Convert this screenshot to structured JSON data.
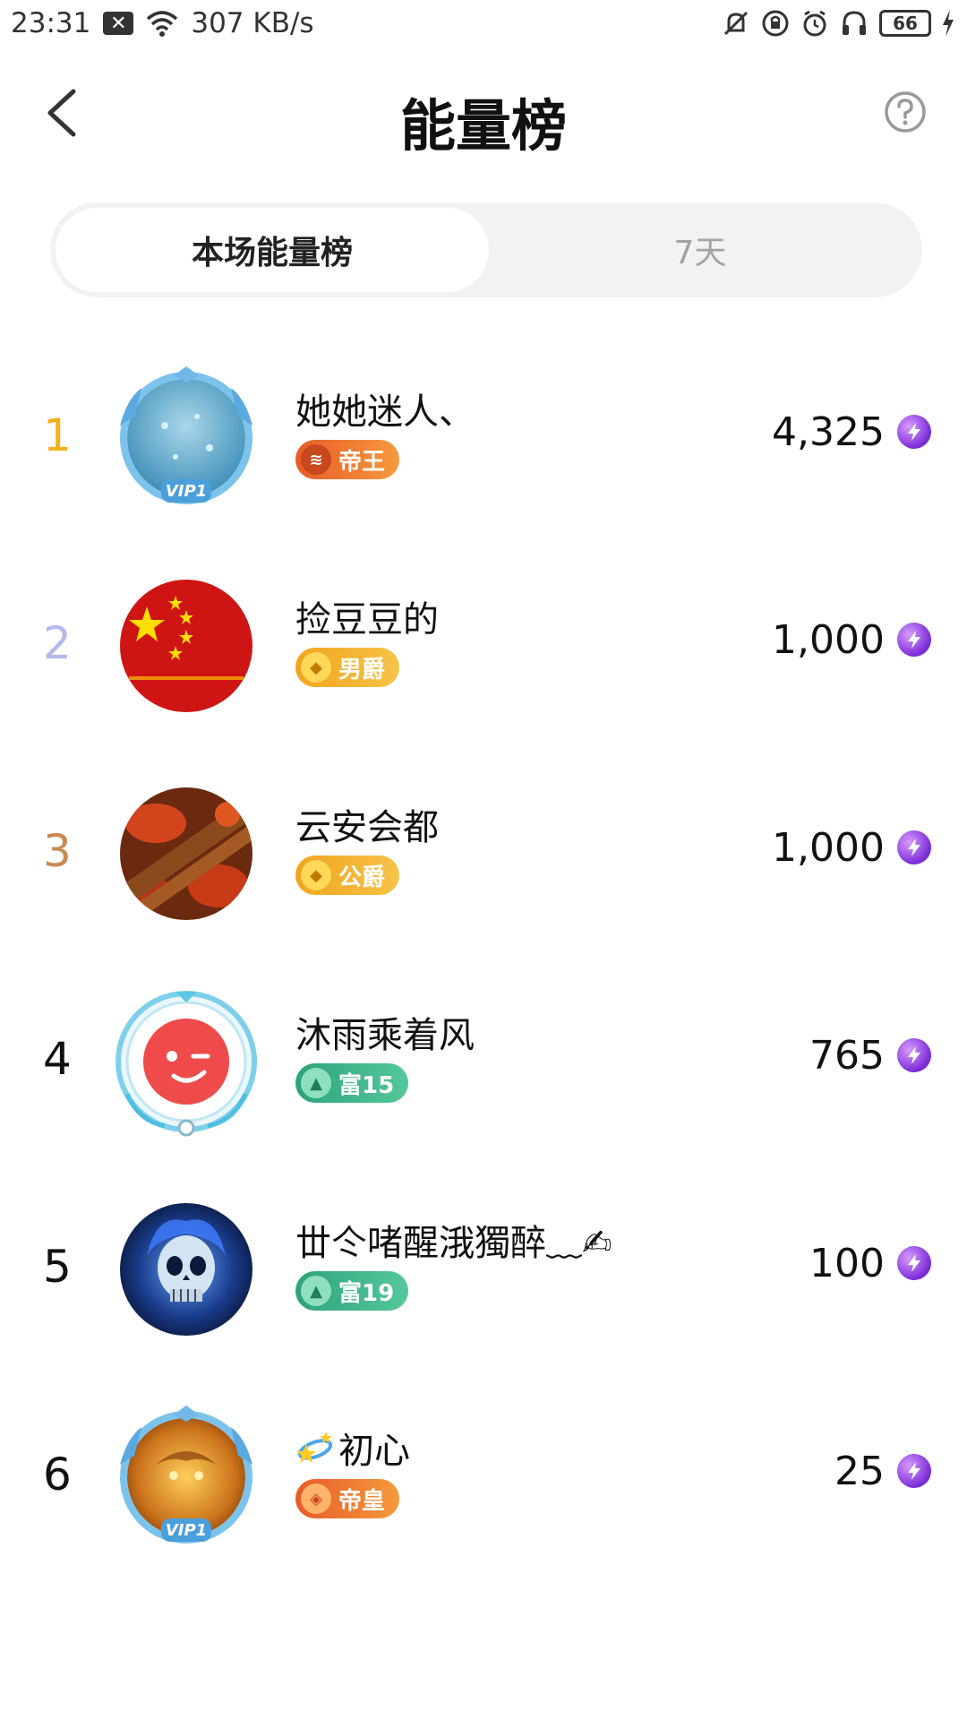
{
  "status_bar": {
    "time": "23:31",
    "speed": "307 KB/s",
    "battery": "66"
  },
  "header": {
    "title": "能量榜"
  },
  "tabs": [
    {
      "label": "本场能量榜",
      "active": true
    },
    {
      "label": "7天",
      "active": false
    }
  ],
  "rankings": [
    {
      "rank": "1",
      "rank_color": "#f3b21b",
      "name": "她她迷人、",
      "badge": "帝王",
      "badge_color": "#ee6a2a",
      "score": "4,325",
      "avatar": "vip-frame-water"
    },
    {
      "rank": "2",
      "rank_color": "#b4b8ee",
      "name": "捡豆豆的",
      "badge": "男爵",
      "badge_color": "#f0a51c",
      "score": "1,000",
      "avatar": "china-flag"
    },
    {
      "rank": "3",
      "rank_color": "#c98a52",
      "name": "云安会都",
      "badge": "公爵",
      "badge_color": "#f0a51c",
      "score": "1,000",
      "avatar": "crawfish-skewers"
    },
    {
      "rank": "4",
      "rank_color": "#111111",
      "name": "沐雨乘着风",
      "badge": "富15",
      "badge_color": "#3fb38a",
      "score": "765",
      "avatar": "red-wink-face"
    },
    {
      "rank": "5",
      "rank_color": "#111111",
      "name": "丗仒啫醒涐獨醉﹏✍",
      "badge": "富19",
      "badge_color": "#3fb38a",
      "score": "100",
      "avatar": "blue-flame-skull"
    },
    {
      "rank": "6",
      "rank_color": "#111111",
      "name": "初心",
      "badge": "帝皇",
      "badge_color": "#ee6a2a",
      "score": "25",
      "avatar": "vip-frame-dragon"
    }
  ]
}
